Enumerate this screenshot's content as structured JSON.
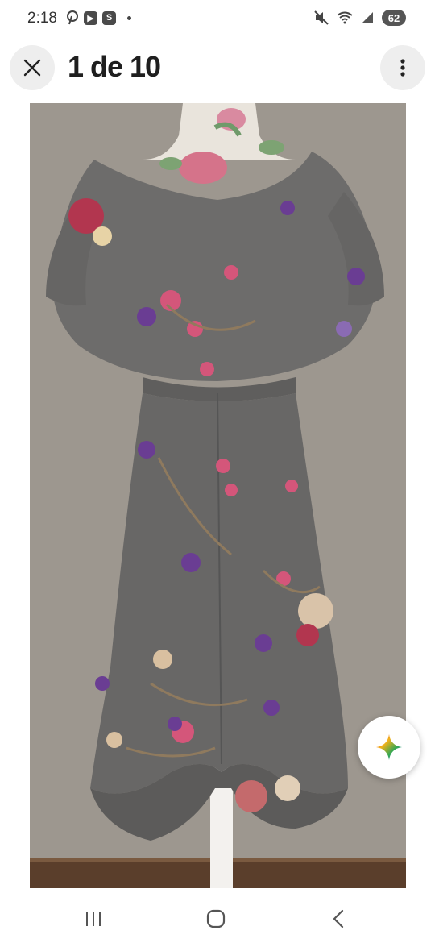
{
  "status_bar": {
    "time": "2:18",
    "left_icons": [
      "pinterest-icon",
      "youtube-icon",
      "s-app-icon"
    ],
    "right_icons": [
      "mute-icon",
      "wifi-icon",
      "signal-icon"
    ],
    "battery": "62"
  },
  "header": {
    "title": "1 de 10",
    "close_icon": "close-icon",
    "more_icon": "more-vert-icon"
  },
  "photo": {
    "subject": "dress-photo"
  },
  "fab": {
    "icon": "sparkle-icon"
  },
  "nav_bar": {
    "items": [
      "recent-apps-icon",
      "home-icon",
      "back-icon"
    ]
  },
  "colors": {
    "background": "#ffffff",
    "button_bg": "#eeeeee",
    "dress_gray": "#6b6a69",
    "wall": "#9b958d"
  }
}
